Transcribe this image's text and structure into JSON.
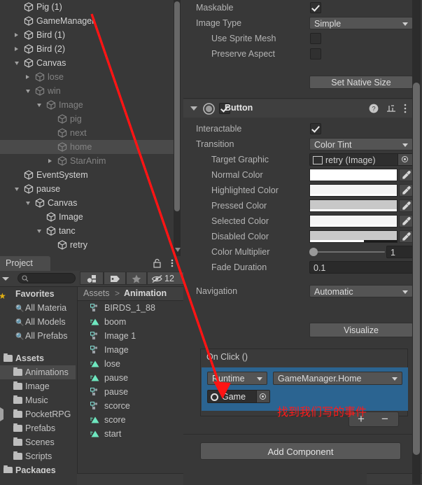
{
  "hierarchy": {
    "items": [
      {
        "label": "Pig (1)",
        "depth": 2,
        "fold": "none",
        "active": true
      },
      {
        "label": "GameManager",
        "depth": 2,
        "fold": "none",
        "active": true
      },
      {
        "label": "Bird (1)",
        "depth": 2,
        "fold": "closed",
        "active": true
      },
      {
        "label": "Bird (2)",
        "depth": 2,
        "fold": "closed",
        "active": true
      },
      {
        "label": "Canvas",
        "depth": 2,
        "fold": "open",
        "active": true
      },
      {
        "label": "lose",
        "depth": 3,
        "fold": "closed",
        "active": false
      },
      {
        "label": "win",
        "depth": 3,
        "fold": "open",
        "active": false
      },
      {
        "label": "Image",
        "depth": 4,
        "fold": "open",
        "active": false
      },
      {
        "label": "pig",
        "depth": 5,
        "fold": "none",
        "active": false
      },
      {
        "label": "next",
        "depth": 5,
        "fold": "none",
        "active": false
      },
      {
        "label": "home",
        "depth": 5,
        "fold": "none",
        "active": false,
        "selected": true
      },
      {
        "label": "StarAnim",
        "depth": 5,
        "fold": "closed",
        "active": false
      },
      {
        "label": "EventSystem",
        "depth": 2,
        "fold": "none",
        "active": true
      },
      {
        "label": "pause",
        "depth": 2,
        "fold": "open",
        "active": true
      },
      {
        "label": "Canvas",
        "depth": 3,
        "fold": "open",
        "active": true
      },
      {
        "label": "Image",
        "depth": 4,
        "fold": "none",
        "active": true
      },
      {
        "label": "tanc",
        "depth": 4,
        "fold": "open",
        "active": true
      },
      {
        "label": "retry",
        "depth": 5,
        "fold": "none",
        "active": true
      }
    ]
  },
  "project": {
    "tab_label": "Project",
    "lock_icon": "lock-icon",
    "menu_icon": "kebab-menu-icon",
    "toolbar": {
      "search_placeholder": "",
      "search_icon": "search-icon",
      "filter_type_icon": "filter-by-type-icon",
      "filter_label_icon": "filter-by-label-icon",
      "favorite_icon": "star-icon",
      "hidden_icon": "eye-slash-icon",
      "hidden_count": "12"
    },
    "breadcrumb": [
      "Assets",
      "Animation"
    ],
    "breadcrumb_sep": ">",
    "tree": [
      {
        "label": "Favorites",
        "icon": "star-icon",
        "header": true,
        "depth": 0
      },
      {
        "label": "All Materia",
        "icon": "search-icon",
        "depth": 1
      },
      {
        "label": "All Models",
        "icon": "search-icon",
        "depth": 1
      },
      {
        "label": "All Prefabs",
        "icon": "search-icon",
        "depth": 1
      },
      {
        "label": "",
        "icon": "none",
        "depth": 0,
        "spacer": true
      },
      {
        "label": "Assets",
        "icon": "folder-open-icon",
        "header": true,
        "depth": 0
      },
      {
        "label": "Animations",
        "icon": "folder-icon",
        "depth": 1,
        "selected": true
      },
      {
        "label": "Image",
        "icon": "folder-icon",
        "depth": 1
      },
      {
        "label": "Music",
        "icon": "folder-icon",
        "depth": 1
      },
      {
        "label": "PocketRPG",
        "icon": "folder-icon",
        "depth": 1,
        "fold": "closed"
      },
      {
        "label": "Prefabs",
        "icon": "folder-icon",
        "depth": 1
      },
      {
        "label": "Scenes",
        "icon": "folder-icon",
        "depth": 1
      },
      {
        "label": "Scripts",
        "icon": "folder-icon",
        "depth": 1
      },
      {
        "label": "Packages",
        "icon": "folder-icon",
        "header": true,
        "depth": 0
      }
    ],
    "assets": [
      {
        "label": "BIRDS_1_88",
        "icon": "animator-controller-icon"
      },
      {
        "label": "boom",
        "icon": "animation-clip-icon"
      },
      {
        "label": "Image 1",
        "icon": "animator-controller-icon"
      },
      {
        "label": "Image",
        "icon": "animator-controller-icon"
      },
      {
        "label": "lose",
        "icon": "animation-clip-icon"
      },
      {
        "label": "pause",
        "icon": "animation-clip-icon"
      },
      {
        "label": "pause",
        "icon": "animator-controller-icon"
      },
      {
        "label": "scorce",
        "icon": "animator-controller-icon"
      },
      {
        "label": "score",
        "icon": "animation-clip-icon"
      },
      {
        "label": "start",
        "icon": "animation-clip-icon"
      }
    ]
  },
  "inspector": {
    "image_component": {
      "rows": [
        {
          "label": "Maskable",
          "type": "checkbox",
          "value": true,
          "indent": 0
        },
        {
          "label": "Image Type",
          "type": "dropdown",
          "value": "Simple",
          "indent": 0
        },
        {
          "label": "Use Sprite Mesh",
          "type": "checkbox",
          "value": false,
          "indent": 1
        },
        {
          "label": "Preserve Aspect",
          "type": "checkbox",
          "value": false,
          "indent": 1
        }
      ],
      "set_native_size_label": "Set Native Size"
    },
    "button_component": {
      "title": "Button",
      "enabled": true,
      "foldout": "open",
      "help_icon": "help-icon",
      "preset_icon": "preset-icon",
      "menu_icon": "kebab-menu-icon",
      "rows": [
        {
          "label": "Interactable",
          "type": "checkbox",
          "value": true,
          "indent": 0
        },
        {
          "label": "Transition",
          "type": "dropdown",
          "value": "Color Tint",
          "indent": 0
        },
        {
          "label": "Target Graphic",
          "type": "object",
          "value": "retry (Image)",
          "indent": 1
        },
        {
          "label": "Normal Color",
          "type": "color",
          "color": "#ffffff",
          "alpha": 100,
          "indent": 1
        },
        {
          "label": "Highlighted Color",
          "type": "color",
          "color": "#f5f5f5",
          "alpha": 100,
          "indent": 1
        },
        {
          "label": "Pressed Color",
          "type": "color",
          "color": "#c8c8c8",
          "alpha": 100,
          "indent": 1
        },
        {
          "label": "Selected Color",
          "type": "color",
          "color": "#f5f5f5",
          "alpha": 100,
          "indent": 1
        },
        {
          "label": "Disabled Color",
          "type": "color",
          "color": "#c8c8c8",
          "alpha": 62,
          "indent": 1
        },
        {
          "label": "Color Multiplier",
          "type": "slider",
          "value": "1",
          "indent": 1
        },
        {
          "label": "Fade Duration",
          "type": "number",
          "value": "0.1",
          "indent": 1
        },
        {
          "label": "Navigation",
          "type": "dropdown",
          "value": "Automatic",
          "indent": 0
        }
      ],
      "visualize_label": "Visualize",
      "on_click": {
        "title": "On Click ()",
        "entry": {
          "runtime_mode": "Runtime",
          "function": "GameManager.Home",
          "object": "Game"
        },
        "add_label": "+",
        "remove_label": "−"
      }
    },
    "add_component_label": "Add Component"
  },
  "annotation": {
    "text": "找到我们写的事件",
    "color": "#ff1a1a",
    "arrow": "red-arrow"
  }
}
